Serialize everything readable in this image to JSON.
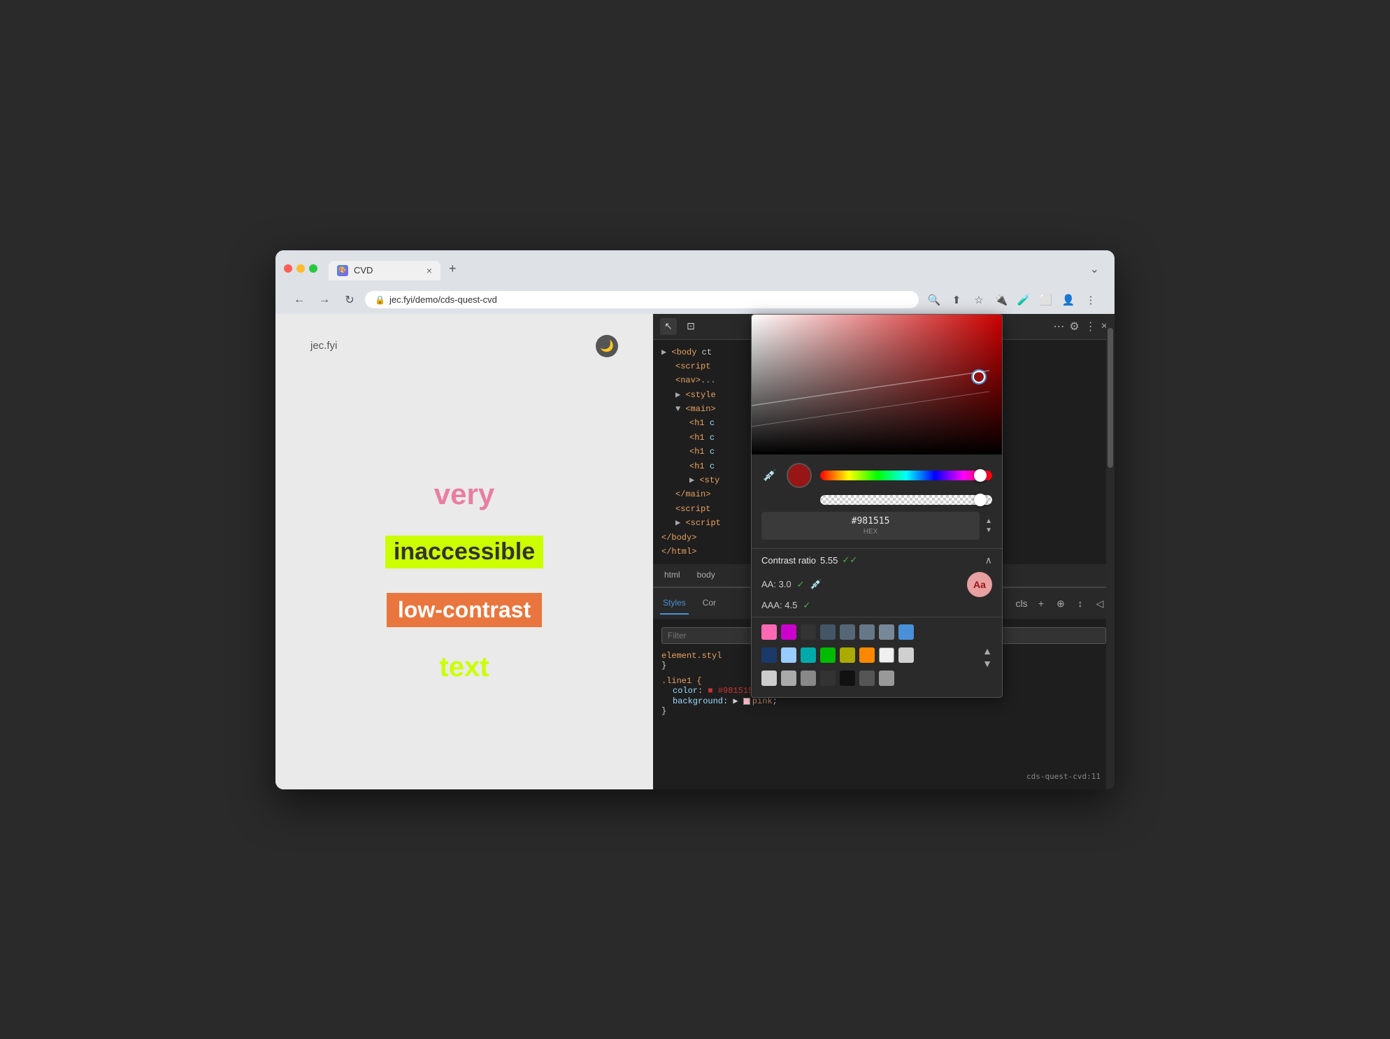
{
  "browser": {
    "traffic_lights": [
      "close",
      "minimize",
      "maximize"
    ],
    "tab": {
      "favicon": "🎨",
      "title": "CVD",
      "close_label": "×"
    },
    "new_tab_label": "+",
    "tab_end_label": "⌄",
    "address": "jec.fyi/demo/cds-quest-cvd",
    "nav_back": "←",
    "nav_forward": "→",
    "nav_reload": "↻",
    "toolbar_icons": [
      "🔍",
      "⬆",
      "☆",
      "🔌",
      "🧪",
      "⬜",
      "👤",
      "⋮"
    ]
  },
  "page": {
    "site_name": "jec.fyi",
    "dark_mode_icon": "🌙",
    "words": [
      {
        "text": "very",
        "class": "word-very"
      },
      {
        "text": "inaccessible",
        "class": "word-inaccessible"
      },
      {
        "text": "low-contrast",
        "class": "word-low-contrast"
      },
      {
        "text": "text",
        "class": "word-text"
      }
    ]
  },
  "devtools": {
    "toolbar_icons": [
      "↖",
      "⊡",
      "⋯"
    ],
    "gear_icon": "⚙",
    "dots_icon": "⋮",
    "close_icon": "×",
    "dom_tree": [
      {
        "indent": 0,
        "html": "▶ <body ct"
      },
      {
        "indent": 1,
        "html": "<script"
      },
      {
        "indent": 1,
        "html": "<nav>..."
      },
      {
        "indent": 1,
        "html": "▶ <style"
      },
      {
        "indent": 1,
        "html": "▼ <main>"
      },
      {
        "indent": 2,
        "html": "<h1 c"
      },
      {
        "indent": 2,
        "html": "<h1 c"
      },
      {
        "indent": 2,
        "html": "<h1 c"
      },
      {
        "indent": 2,
        "html": "<h1 c"
      },
      {
        "indent": 2,
        "html": "▶ <sty"
      },
      {
        "indent": 1,
        "html": "</main>"
      },
      {
        "indent": 1,
        "html": "<script"
      },
      {
        "indent": 1,
        "html": "▶ <script"
      },
      {
        "indent": 0,
        "html": "</body>"
      },
      {
        "indent": 0,
        "html": "</html>"
      }
    ],
    "color_picker": {
      "hex_value": "#981515",
      "hex_label": "HEX",
      "contrast_ratio_label": "Contrast ratio",
      "contrast_ratio_value": "5.55",
      "contrast_check_icon": "✓✓",
      "aa_label": "AA: 3.0",
      "aaa_label": "AAA: 4.5",
      "pass_icon": "✓",
      "aa_preview_text": "Aa",
      "swatches_row1": [
        "#ff69b4",
        "#cc00cc",
        "#333333",
        "#445566",
        "#556677",
        "#667788",
        "#778899",
        "#4a90d9"
      ],
      "swatches_row2": [
        "#1a3a6a",
        "#99ccff",
        "#00aaaa",
        "#00bb00",
        "#aaaa00",
        "#ff8800",
        "#f0f0f0",
        "#d0d0d0"
      ],
      "swatches_row3": [
        "#cccccc",
        "#aaaaaa",
        "#888888",
        "#333333",
        "#111111",
        "#555555",
        "#999999"
      ]
    },
    "tabs": [
      "html",
      "body"
    ],
    "styles_tabs": [
      {
        "label": "Styles",
        "active": true
      },
      {
        "label": "Cor",
        "active": false
      }
    ],
    "filter_placeholder": "Filter",
    "styles_code": [
      "element.styl",
      "}",
      "",
      ".line1 {",
      "    color: #981515;",
      "    background: ▶ 🟪 pink;"
    ],
    "file_ref": "cds-quest-cvd:11",
    "bottom_toolbar": [
      "+",
      "cls",
      "↕",
      "◁"
    ]
  }
}
